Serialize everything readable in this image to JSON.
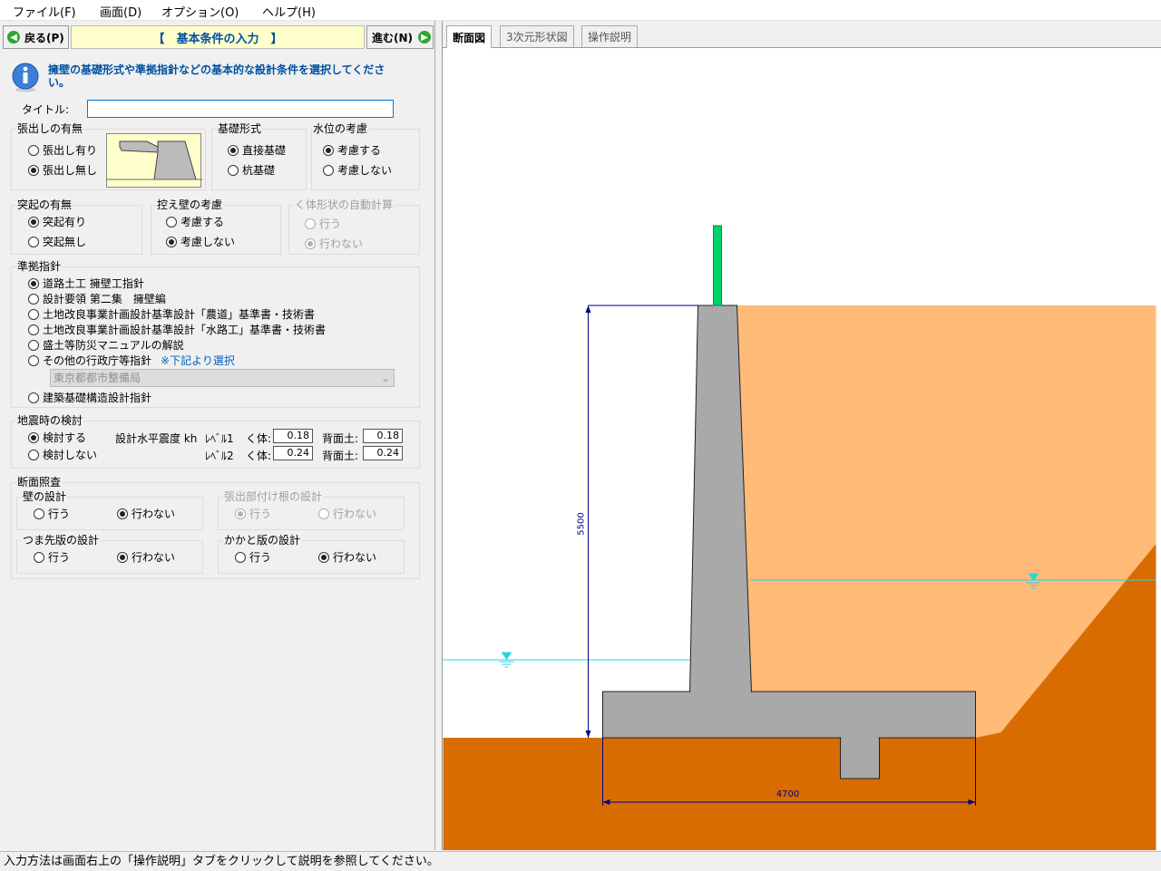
{
  "menu": [
    "ファイル(F)",
    "画面(D)",
    "オプション(O)",
    "ヘルプ(H)"
  ],
  "nav": {
    "back": "戻る(P)",
    "next": "進む(N)",
    "heading": "【　基本条件の入力　】"
  },
  "info": {
    "line1": "擁壁の基礎形式や準拠指針などの基本的な設計条件を選択してくださ",
    "line2": "い。"
  },
  "title_field": {
    "label": "タイトル:",
    "value": ""
  },
  "overhang": {
    "title": "張出しの有無",
    "options": [
      "張出し有り",
      "張出し無し"
    ],
    "selected": "張出し無し"
  },
  "foundation": {
    "title": "基礎形式",
    "options": [
      "直接基礎",
      "杭基礎"
    ],
    "selected": "直接基礎"
  },
  "water": {
    "title": "水位の考慮",
    "options": [
      "考慮する",
      "考慮しない"
    ],
    "selected": "考慮する"
  },
  "projection": {
    "title": "突起の有無",
    "options": [
      "突起有り",
      "突起無し"
    ],
    "selected": "突起有り"
  },
  "counterfort": {
    "title": "控え壁の考慮",
    "options": [
      "考慮する",
      "考慮しない"
    ],
    "selected": "考慮しない"
  },
  "autoshape": {
    "title": "く体形状の自動計算",
    "options": [
      "行う",
      "行わない"
    ],
    "selected": "行わない"
  },
  "standard": {
    "title": "準拠指針",
    "options": [
      "道路土工 擁壁工指針",
      "設計要領 第二集　擁壁編",
      "土地改良事業計画設計基準設計「農道」基準書・技術書",
      "土地改良事業計画設計基準設計「水路工」基準書・技術書",
      "盛土等防災マニュアルの解説",
      "その他の行政庁等指針",
      "建築基礎構造設計指針"
    ],
    "selected": "道路土工 擁壁工指針",
    "note": "※下記より選択",
    "dropdown": "東京都都市整備局"
  },
  "seismic": {
    "title": "地震時の検討",
    "options": [
      "検討する",
      "検討しない"
    ],
    "selected": "検討する",
    "coef_label": "設計水平震度 kh",
    "level1": "ﾚﾍﾞﾙ1",
    "level2": "ﾚﾍﾞﾙ2",
    "body_label": "く体:",
    "back_label": "背面土:",
    "l1_body": "0.18",
    "l1_back": "0.18",
    "l2_body": "0.24",
    "l2_back": "0.24"
  },
  "section": {
    "title": "断面照査",
    "wall": {
      "title": "壁の設計",
      "options": [
        "行う",
        "行わない"
      ],
      "selected": "行わない"
    },
    "root": {
      "title": "張出部付け根の設計",
      "options": [
        "行う",
        "行わない"
      ],
      "selected": "行う"
    },
    "toe": {
      "title": "つま先版の設計",
      "options": [
        "行う",
        "行わない"
      ],
      "selected": "行わない"
    },
    "heel": {
      "title": "かかと版の設計",
      "options": [
        "行う",
        "行わない"
      ],
      "selected": "行わない"
    }
  },
  "tabs": [
    "断面図",
    "3次元形状図",
    "操作説明"
  ],
  "drawing": {
    "height_dim": "5500",
    "width_dim": "4700"
  },
  "colors": {
    "backfill": "#ffbb77",
    "ground": "#d96c00",
    "concrete": "#a9a9a9",
    "fence": "#00d26a",
    "water": "#22d4e8",
    "dim": "#000080"
  },
  "status": "入力方法は画面右上の「操作説明」タブをクリックして説明を参照してください。"
}
